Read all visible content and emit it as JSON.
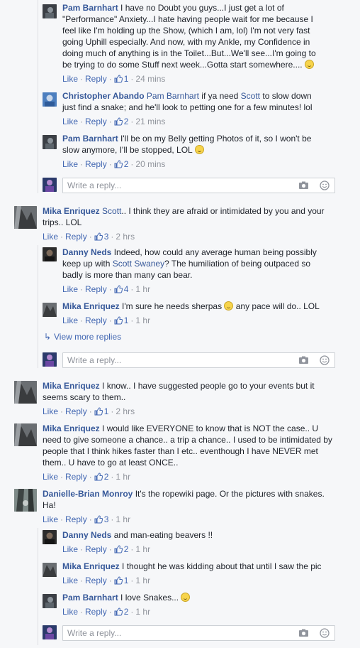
{
  "actions": {
    "like": "Like",
    "reply": "Reply"
  },
  "reply_placeholder": "Write a reply...",
  "view_more": "View more replies",
  "comments": {
    "c1": {
      "author": "Pam Barnhart",
      "text": "I have no Doubt you guys...I just get a lot of \"Performance\" Anxiety...I hate having people wait for me because I feel like I'm holding up the Show, (which I am, lol) I'm not very fast going Uphill especially. And now, with my Ankle, my Confidence in doing much of anything is in the Toilet...But...We'll see...I'm going to be trying to do some Stuff next week...Gotta start somewhere....",
      "likes": "1",
      "time": "24 mins"
    },
    "c2": {
      "author": "Christopher Abando",
      "mention1": "Pam Barnhart",
      "text1": " if ya need ",
      "mention2": "Scott",
      "text2": " to slow down just find a snake; and he'll look to petting one for a few minutes! lol",
      "likes": "2",
      "time": "21 mins"
    },
    "c3": {
      "author": "Pam Barnhart",
      "text": "I'll be on my Belly getting Photos of it, so I won't be slow anymore, I'll be stopped, LOL",
      "likes": "2",
      "time": "20 mins"
    },
    "c4": {
      "author": "Mika Enriquez",
      "mention": "Scott",
      "text": ".. I think they are afraid or intimidated by you and your trips.. LOL",
      "likes": "3",
      "time": "2 hrs"
    },
    "c5": {
      "author": "Danny Neds",
      "text1": "Indeed, how could any average human being possibly keep up with ",
      "mention": "Scott Swaney",
      "text2": "? The humiliation of being outpaced so badly is more than many can bear.",
      "likes": "4",
      "time": "1 hr"
    },
    "c6": {
      "author": "Mika Enriquez",
      "text1": "I'm sure he needs sherpas ",
      "text2": " any pace will do.. LOL",
      "likes": "1",
      "time": "1 hr"
    },
    "c7": {
      "author": "Mika Enriquez",
      "text": "I know.. I have suggested people go to your events but it seems scary to them..",
      "likes": "1",
      "time": "2 hrs"
    },
    "c8": {
      "author": "Mika Enriquez",
      "text": "I would like EVERYONE to know that is NOT the case.. U need to give someone a chance.. a trip a chance.. I used to be intimidated by people that I think hikes faster than I etc.. eventhough I have NEVER met them.. U have to go at least ONCE..",
      "likes": "2",
      "time": "1 hr"
    },
    "c9": {
      "author": "Danielle-Brian Monroy",
      "text": "It's the ropewiki page. Or the pictures with snakes. Ha!",
      "likes": "3",
      "time": "1 hr"
    },
    "c10": {
      "author": "Danny Neds",
      "text": "and man-eating beavers !!",
      "likes": "2",
      "time": "1 hr"
    },
    "c11": {
      "author": "Mika Enriquez",
      "text": "I thought he was kidding about that until I saw the pic",
      "likes": "1",
      "time": "1 hr"
    },
    "c12": {
      "author": "Pam Barnhart",
      "text": "I love Snakes...",
      "likes": "2",
      "time": "1 hr"
    }
  }
}
